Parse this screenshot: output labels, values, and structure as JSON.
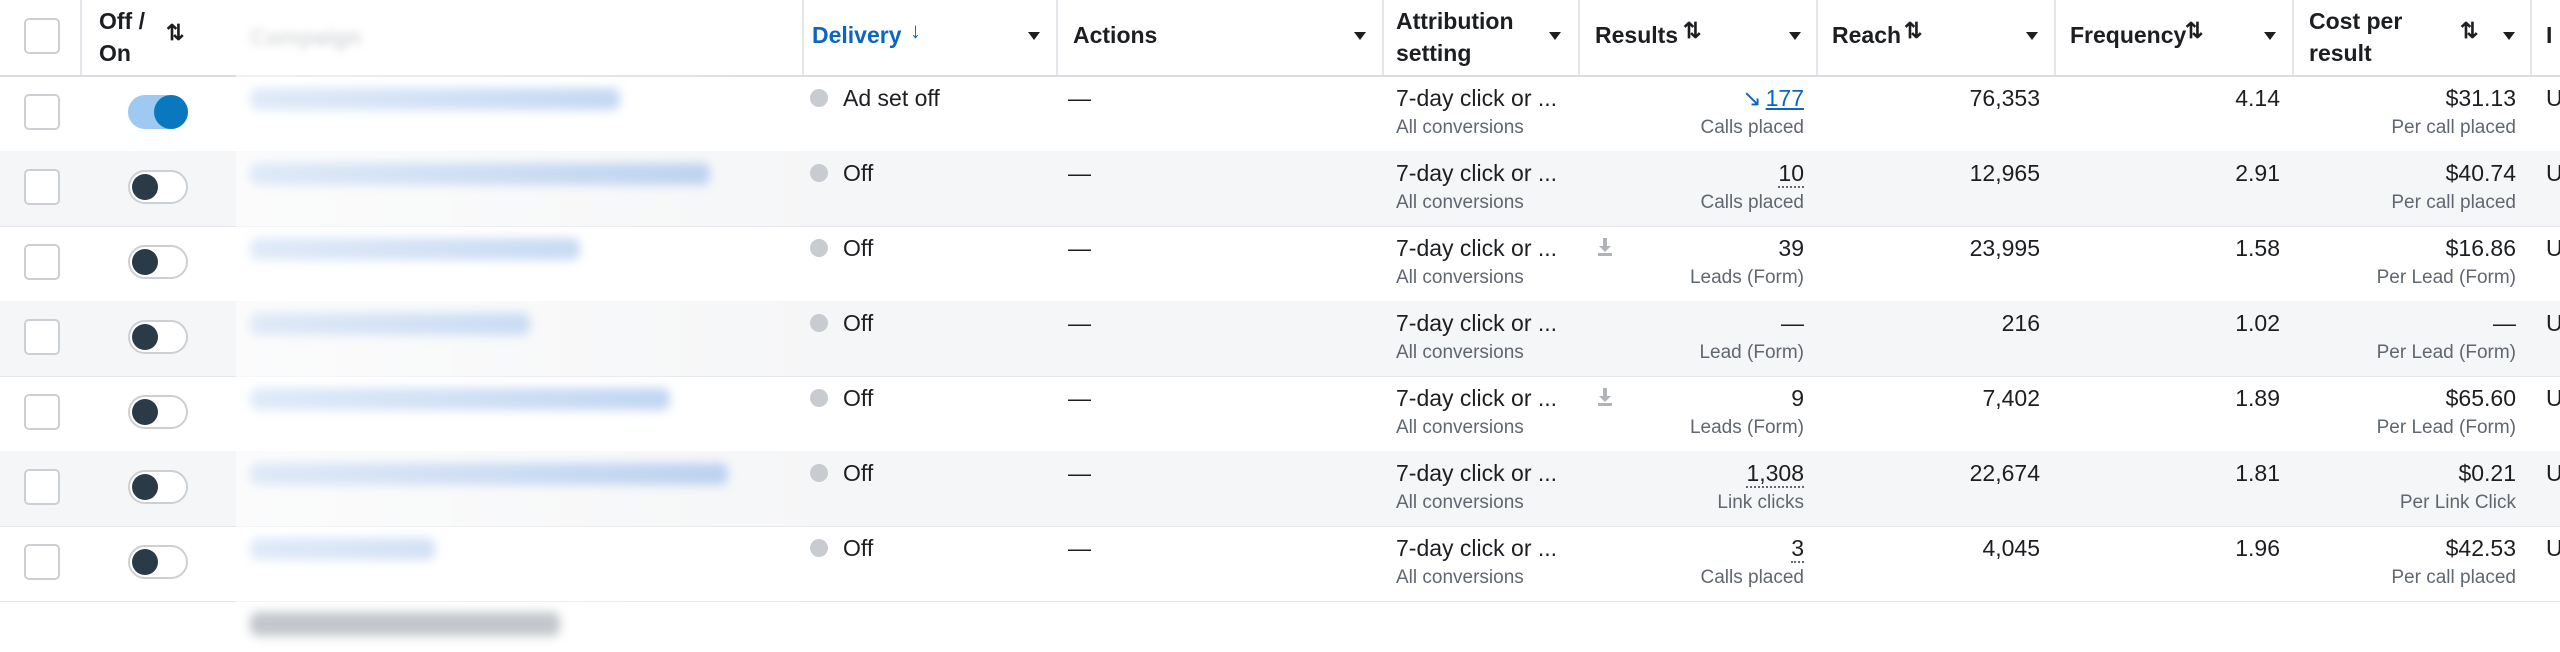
{
  "header": {
    "off_on": "Off /",
    "off_on2": "On",
    "campaign": "Campaign",
    "delivery": "Delivery",
    "actions": "Actions",
    "attribution": "Attribution",
    "attribution2": "setting",
    "results": "Results",
    "reach": "Reach",
    "frequency": "Frequency",
    "cost": "Cost per",
    "cost2": "result",
    "overflow": "U",
    "overflow_hdr": "I"
  },
  "rows": [
    {
      "toggle": "on",
      "delivery": "Ad set off",
      "actions": "—",
      "attr": "7-day click or ...",
      "attr_sub": "All conversions",
      "result": "177",
      "result_style": "link",
      "result_trend": "↘",
      "result_sub": "Calls placed",
      "reach": "76,353",
      "freq": "4.14",
      "cost": "$31.13",
      "cost_sub": "Per call placed"
    },
    {
      "toggle": "off",
      "delivery": "Off",
      "actions": "—",
      "attr": "7-day click or ...",
      "attr_sub": "All conversions",
      "result": "10",
      "result_style": "dotted",
      "result_sub": "Calls placed",
      "reach": "12,965",
      "freq": "2.91",
      "cost": "$40.74",
      "cost_sub": "Per call placed"
    },
    {
      "toggle": "off",
      "delivery": "Off",
      "actions": "—",
      "attr": "7-day click or ...",
      "attr_sub": "All conversions",
      "result": "39",
      "result_style": "plain",
      "download": true,
      "result_sub": "Leads (Form)",
      "reach": "23,995",
      "freq": "1.58",
      "cost": "$16.86",
      "cost_sub": "Per Lead (Form)"
    },
    {
      "toggle": "off",
      "delivery": "Off",
      "actions": "—",
      "attr": "7-day click or ...",
      "attr_sub": "All conversions",
      "result": "—",
      "result_style": "plain",
      "result_sub": "Lead (Form)",
      "reach": "216",
      "freq": "1.02",
      "cost": "—",
      "cost_sub": "Per Lead (Form)"
    },
    {
      "toggle": "off",
      "delivery": "Off",
      "actions": "—",
      "attr": "7-day click or ...",
      "attr_sub": "All conversions",
      "result": "9",
      "result_style": "plain",
      "download": true,
      "result_sub": "Leads (Form)",
      "reach": "7,402",
      "freq": "1.89",
      "cost": "$65.60",
      "cost_sub": "Per Lead (Form)"
    },
    {
      "toggle": "off",
      "delivery": "Off",
      "actions": "—",
      "attr": "7-day click or ...",
      "attr_sub": "All conversions",
      "result": "1,308",
      "result_style": "dotted",
      "result_sub": "Link clicks",
      "reach": "22,674",
      "freq": "1.81",
      "cost": "$0.21",
      "cost_sub": "Per Link Click"
    },
    {
      "toggle": "off",
      "delivery": "Off",
      "actions": "—",
      "attr": "7-day click or ...",
      "attr_sub": "All conversions",
      "result": "3",
      "result_style": "dotted",
      "result_sub": "Calls placed",
      "reach": "4,045",
      "freq": "1.96",
      "cost": "$42.53",
      "cost_sub": "Per call placed"
    }
  ],
  "colors": {
    "accent": "#0a66c2",
    "toggle_on": "#0a78be",
    "status_dot": "#c8ccd1"
  }
}
